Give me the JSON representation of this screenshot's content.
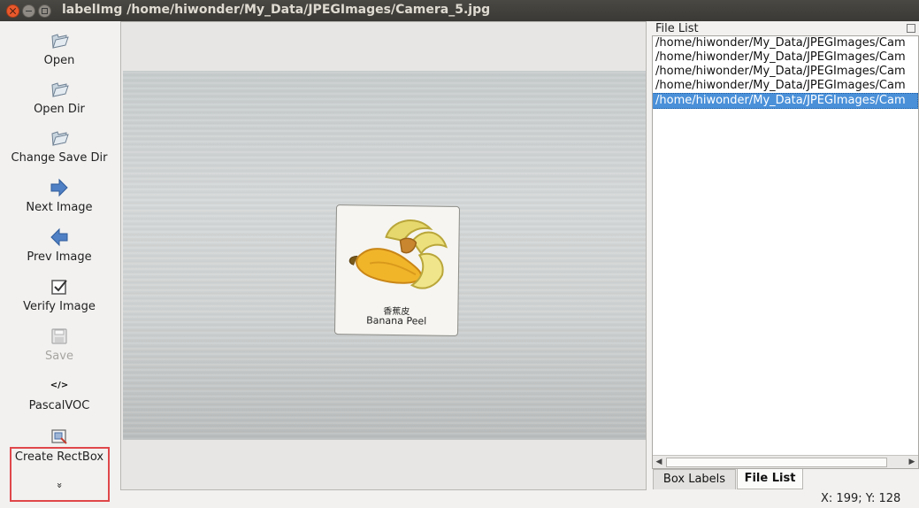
{
  "window": {
    "title": "labelImg /home/hiwonder/My_Data/JPEGImages/Camera_5.jpg"
  },
  "toolbar": {
    "items": [
      {
        "label": "Open",
        "icon": "folder-icon",
        "enabled": true
      },
      {
        "label": "Open Dir",
        "icon": "folder-icon",
        "enabled": true
      },
      {
        "label": "Change Save Dir",
        "icon": "folder-icon",
        "enabled": true
      },
      {
        "label": "Next Image",
        "icon": "arrow-right-icon",
        "enabled": true
      },
      {
        "label": "Prev Image",
        "icon": "arrow-left-icon",
        "enabled": true
      },
      {
        "label": "Verify Image",
        "icon": "checkbox-icon",
        "enabled": true
      },
      {
        "label": "Save",
        "icon": "save-icon",
        "enabled": false
      },
      {
        "label": "PascalVOC",
        "icon": "code-icon",
        "glyph": "</>",
        "enabled": true
      },
      {
        "label": "Create RectBox",
        "icon": "rectbox-icon",
        "enabled": true,
        "highlighted": true
      }
    ],
    "more_glyph": "»"
  },
  "canvas": {
    "card": {
      "label_cn": "香蕉皮",
      "label_en": "Banana Peel"
    }
  },
  "dock": {
    "title": "File List",
    "files": [
      "/home/hiwonder/My_Data/JPEGImages/Cam",
      "/home/hiwonder/My_Data/JPEGImages/Cam",
      "/home/hiwonder/My_Data/JPEGImages/Cam",
      "/home/hiwonder/My_Data/JPEGImages/Cam",
      "/home/hiwonder/My_Data/JPEGImages/Cam"
    ],
    "selected_index": 4,
    "tabs": [
      "Box Labels",
      "File List"
    ],
    "active_tab": "File List"
  },
  "status": {
    "coords": "X: 199; Y: 128"
  },
  "colors": {
    "selection": "#4a90d9",
    "highlight_border": "#e0474a",
    "titlebar": "#3b3935"
  }
}
